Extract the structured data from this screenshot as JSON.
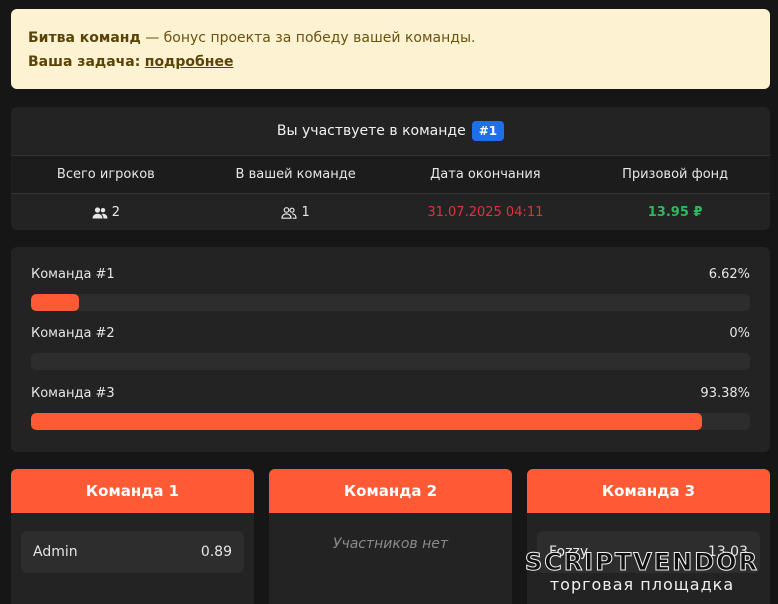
{
  "notice": {
    "title": "Битва команд",
    "text": " — бонус проекта за победу вашей команды.",
    "task_label": "Ваша задача:",
    "link_label": "подробнее"
  },
  "info": {
    "title": "Вы участвуете в команде",
    "team_badge": "#1",
    "headers": [
      "Всего игроков",
      "В вашей команде",
      "Дата окончания",
      "Призовой фонд"
    ],
    "total_players": "2",
    "your_team_players": "1",
    "end_date": "31.07.2025 04:11",
    "prize": "13.95 ₽"
  },
  "progress": [
    {
      "label": "Команда #1",
      "percent_label": "6.62%",
      "value": 6.62
    },
    {
      "label": "Команда #2",
      "percent_label": "0%",
      "value": 0
    },
    {
      "label": "Команда #3",
      "percent_label": "93.38%",
      "value": 93.38
    }
  ],
  "teams": [
    {
      "title": "Команда 1",
      "members": [
        {
          "name": "Admin",
          "score": "0.89"
        }
      ]
    },
    {
      "title": "Команда 2",
      "empty_text": "Участников нет"
    },
    {
      "title": "Команда 3",
      "members": [
        {
          "name": "Fozzy",
          "score": "13.03"
        }
      ]
    }
  ],
  "watermark": {
    "title": "SCRIPTVENDOR",
    "subtitle": "торговая площадка"
  },
  "colors": {
    "accent": "#ff5a36",
    "badge": "#1f6feb",
    "date": "#e0323e",
    "money": "#2eb85c"
  }
}
